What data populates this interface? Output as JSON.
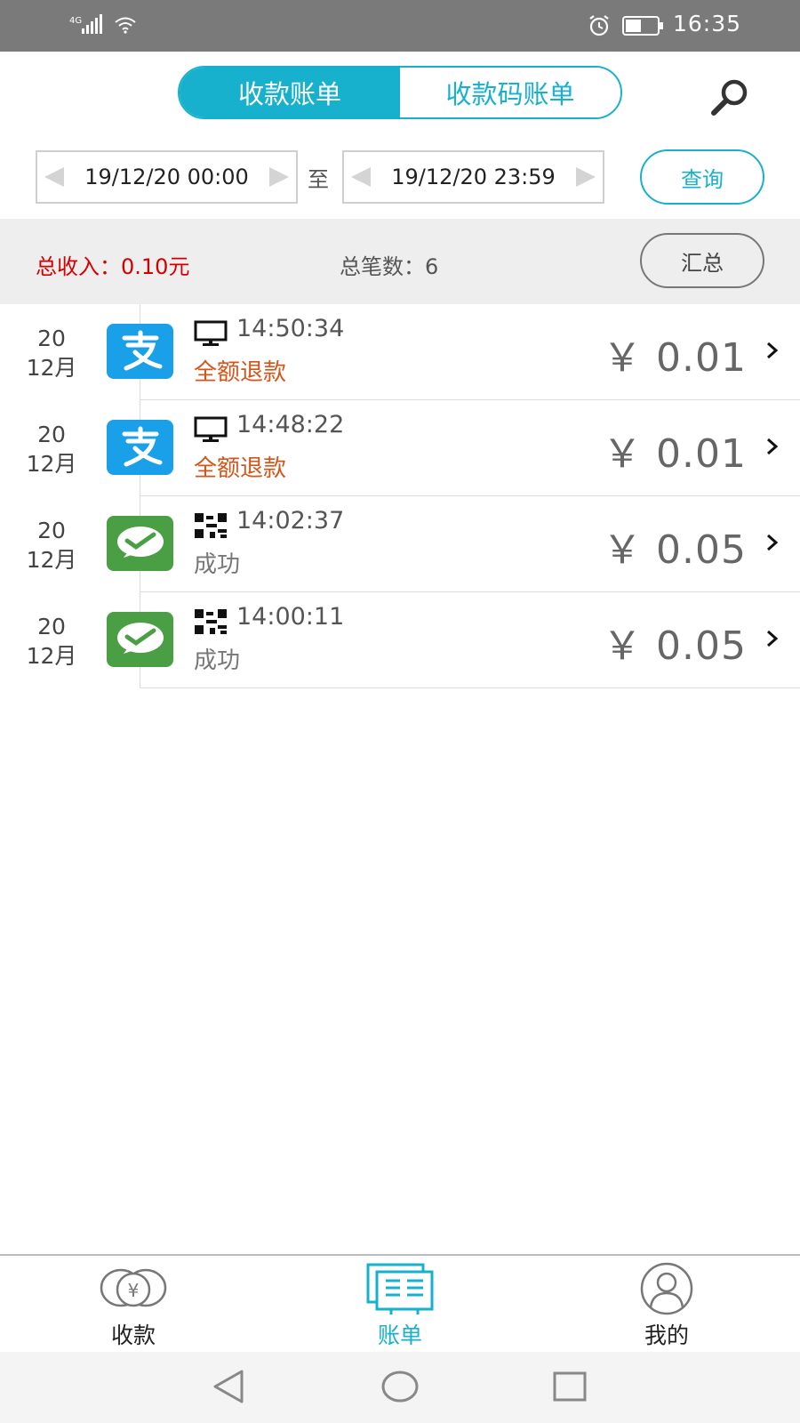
{
  "status_bar": {
    "signal": "4G",
    "clock": "16:35"
  },
  "header": {
    "tabs": [
      {
        "label": "收款账单",
        "active": true
      },
      {
        "label": "收款码账单",
        "active": false
      }
    ],
    "search_icon": "search-icon"
  },
  "filter": {
    "start": "19/12/20 00:00",
    "to_label": "至",
    "end": "19/12/20 23:59",
    "query_label": "查询"
  },
  "summary": {
    "income_label": "总收入：",
    "income_value": "0.10元",
    "count_label": "总笔数：",
    "count_value": "6",
    "summary_button": "汇总"
  },
  "transactions": [
    {
      "day": "20",
      "month": "12月",
      "channel": "alipay",
      "type_icon": "monitor-icon",
      "time": "14:50:34",
      "status": "全额退款",
      "amount": "￥ 0.01"
    },
    {
      "day": "20",
      "month": "12月",
      "channel": "alipay",
      "type_icon": "monitor-icon",
      "time": "14:48:22",
      "status": "全额退款",
      "amount": "￥ 0.01"
    },
    {
      "day": "20",
      "month": "12月",
      "channel": "wechat",
      "type_icon": "qrcode-icon",
      "time": "14:02:37",
      "status": "成功",
      "amount": "￥ 0.05"
    },
    {
      "day": "20",
      "month": "12月",
      "channel": "wechat",
      "type_icon": "qrcode-icon",
      "time": "14:00:11",
      "status": "成功",
      "amount": "￥ 0.05"
    }
  ],
  "tabbar": {
    "items": [
      {
        "label": "收款",
        "icon": "receive-money-icon",
        "active": false
      },
      {
        "label": "账单",
        "icon": "bill-icon",
        "active": true
      },
      {
        "label": "我的",
        "icon": "profile-icon",
        "active": false
      }
    ]
  },
  "colors": {
    "accent": "#17b0cd",
    "income": "#d40000",
    "refund": "#d4541a",
    "alipay": "#1aa0e8",
    "wechat": "#4a9f45"
  }
}
